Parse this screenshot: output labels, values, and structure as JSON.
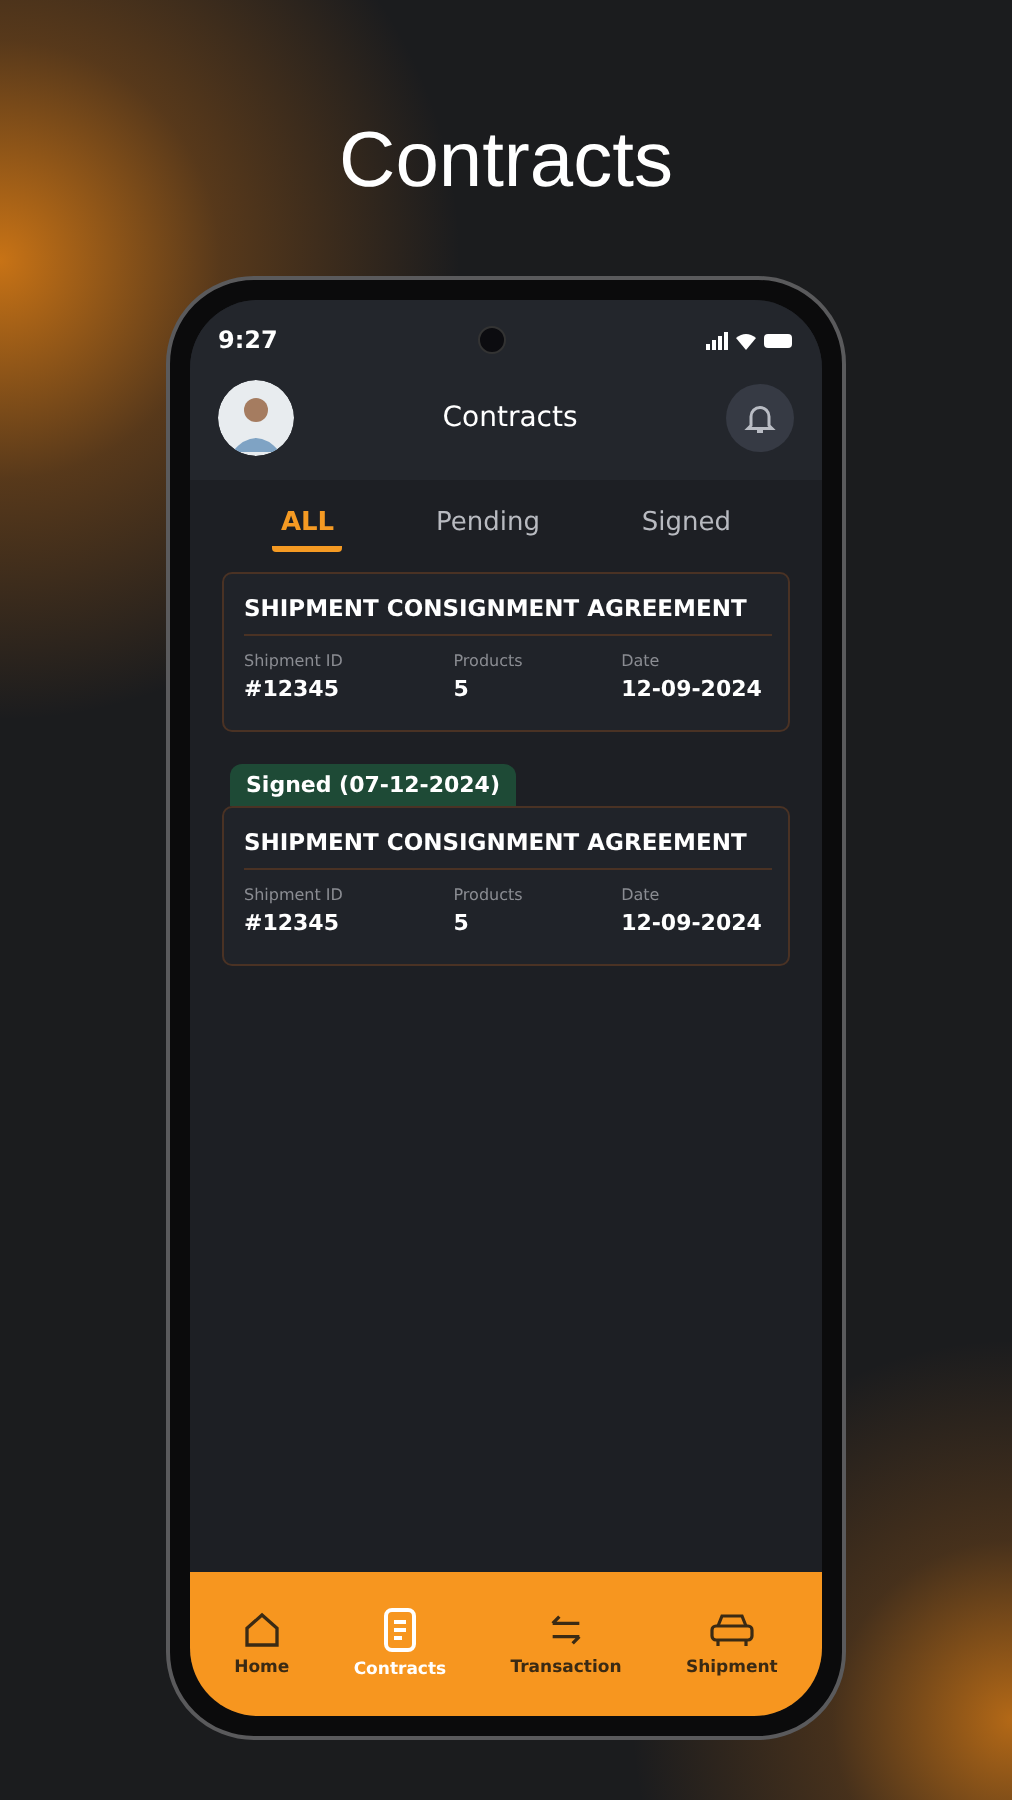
{
  "headline": "Contracts",
  "status_bar": {
    "time": "9:27"
  },
  "header": {
    "title": "Contracts"
  },
  "tabs": [
    {
      "label": "ALL",
      "selected": true
    },
    {
      "label": "Pending",
      "selected": false
    },
    {
      "label": "Signed",
      "selected": false
    }
  ],
  "contracts": [
    {
      "title": "SHIPMENT CONSIGNMENT AGREEMENT",
      "fields": [
        {
          "label": "Shipment ID",
          "value": "#12345"
        },
        {
          "label": "Products",
          "value": "5"
        },
        {
          "label": "Date",
          "value": "12-09-2024"
        }
      ]
    },
    {
      "badge": "Signed (07-12-2024)",
      "title": "SHIPMENT CONSIGNMENT AGREEMENT",
      "fields": [
        {
          "label": "Shipment ID",
          "value": "#12345"
        },
        {
          "label": "Products",
          "value": "5"
        },
        {
          "label": "Date",
          "value": "12-09-2024"
        }
      ]
    }
  ],
  "bottom_nav": [
    {
      "kind": "home",
      "label": "Home",
      "selected": false
    },
    {
      "kind": "contracts",
      "label": "Contracts",
      "selected": true
    },
    {
      "kind": "transaction",
      "label": "Transaction",
      "selected": false
    },
    {
      "kind": "shipment",
      "label": "Shipment",
      "selected": false
    }
  ]
}
